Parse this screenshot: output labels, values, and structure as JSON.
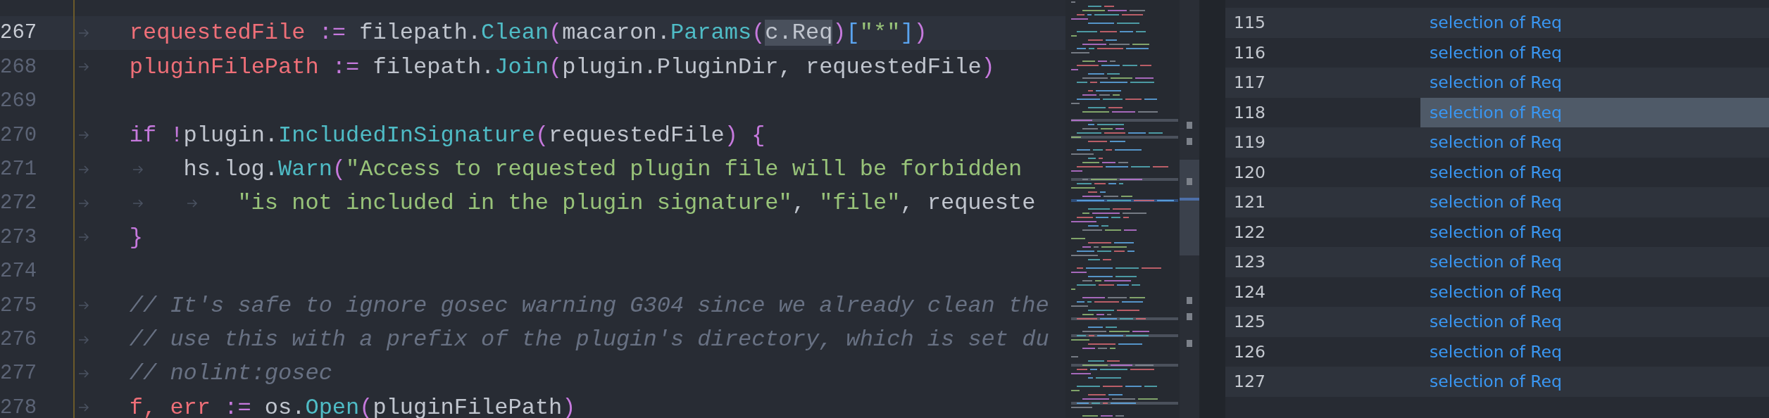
{
  "editor": {
    "lines": [
      {
        "number": "267",
        "current": true,
        "indent": [
          {
            "kind": "tab"
          }
        ],
        "tokens": [
          {
            "kind": "variable",
            "text": "requestedFile"
          },
          {
            "kind": "operator",
            "text": " := "
          },
          {
            "kind": "plain",
            "text": "filepath."
          },
          {
            "kind": "function",
            "text": "Clean"
          },
          {
            "kind": "paren",
            "text": "("
          },
          {
            "kind": "plain",
            "text": "macaron."
          },
          {
            "kind": "function",
            "text": "Params"
          },
          {
            "kind": "paren",
            "text": "("
          },
          {
            "kind": "match",
            "text": "c.Req"
          },
          {
            "kind": "paren",
            "text": ")"
          },
          {
            "kind": "bracket",
            "text": "["
          },
          {
            "kind": "string",
            "text": "\"*\""
          },
          {
            "kind": "bracket",
            "text": "]"
          },
          {
            "kind": "paren",
            "text": ")"
          }
        ]
      },
      {
        "number": "268",
        "current": false,
        "indent": [
          {
            "kind": "tab"
          }
        ],
        "tokens": [
          {
            "kind": "variable",
            "text": "pluginFilePath"
          },
          {
            "kind": "operator",
            "text": " := "
          },
          {
            "kind": "plain",
            "text": "filepath."
          },
          {
            "kind": "function",
            "text": "Join"
          },
          {
            "kind": "paren",
            "text": "("
          },
          {
            "kind": "plain",
            "text": "plugin.PluginDir, requestedFile"
          },
          {
            "kind": "paren",
            "text": ")"
          }
        ]
      },
      {
        "number": "269",
        "current": false
      },
      {
        "number": "270",
        "current": false,
        "indent": [
          {
            "kind": "tab"
          }
        ],
        "tokens": [
          {
            "kind": "keyword",
            "text": "if !"
          },
          {
            "kind": "plain",
            "text": "plugin."
          },
          {
            "kind": "function",
            "text": "IncludedInSignature"
          },
          {
            "kind": "paren",
            "text": "("
          },
          {
            "kind": "plain",
            "text": "requestedFile"
          },
          {
            "kind": "paren",
            "text": ") {"
          }
        ]
      },
      {
        "number": "271",
        "current": false,
        "indent": [
          {
            "kind": "tab"
          },
          {
            "kind": "tab"
          }
        ],
        "tokens": [
          {
            "kind": "plain",
            "text": "hs.log."
          },
          {
            "kind": "function",
            "text": "Warn"
          },
          {
            "kind": "paren",
            "text": "("
          },
          {
            "kind": "string",
            "text": "\"Access to requested plugin file will be forbidden"
          }
        ]
      },
      {
        "number": "272",
        "current": false,
        "indent": [
          {
            "kind": "tab"
          },
          {
            "kind": "tab"
          },
          {
            "kind": "tab"
          }
        ],
        "tokens": [
          {
            "kind": "string",
            "text": "\"is not included in the plugin signature\""
          },
          {
            "kind": "plain",
            "text": ", "
          },
          {
            "kind": "string",
            "text": "\"file\""
          },
          {
            "kind": "plain",
            "text": ", requeste"
          }
        ]
      },
      {
        "number": "273",
        "current": false,
        "indent": [
          {
            "kind": "tab"
          }
        ],
        "tokens": [
          {
            "kind": "paren",
            "text": "}"
          }
        ]
      },
      {
        "number": "274",
        "current": false
      },
      {
        "number": "275",
        "current": false,
        "indent": [
          {
            "kind": "tab"
          }
        ],
        "tokens": [
          {
            "kind": "comment",
            "text": "// It's safe to ignore gosec warning G304 since we already clean the"
          }
        ]
      },
      {
        "number": "276",
        "current": false,
        "indent": [
          {
            "kind": "tab"
          }
        ],
        "tokens": [
          {
            "kind": "comment",
            "text": "// use this with a prefix of the plugin's directory, which is set du"
          }
        ]
      },
      {
        "number": "277",
        "current": false,
        "indent": [
          {
            "kind": "tab"
          }
        ],
        "tokens": [
          {
            "kind": "comment",
            "text": "// nolint:gosec"
          }
        ]
      },
      {
        "number": "278",
        "current": false,
        "indent": [
          {
            "kind": "tab"
          }
        ],
        "tokens": [
          {
            "kind": "variable",
            "text": "f, err"
          },
          {
            "kind": "operator",
            "text": " := "
          },
          {
            "kind": "plain",
            "text": "os."
          },
          {
            "kind": "function",
            "text": "Open"
          },
          {
            "kind": "paren",
            "text": "("
          },
          {
            "kind": "plain",
            "text": "pluginFilePath"
          },
          {
            "kind": "paren",
            "text": ")"
          }
        ]
      }
    ]
  },
  "results": {
    "rows": [
      {
        "line": "115",
        "text": "selection of Req",
        "selected": false
      },
      {
        "line": "116",
        "text": "selection of Req",
        "selected": false
      },
      {
        "line": "117",
        "text": "selection of Req",
        "selected": false
      },
      {
        "line": "118",
        "text": "selection of Req",
        "selected": true
      },
      {
        "line": "119",
        "text": "selection of Req",
        "selected": false
      },
      {
        "line": "120",
        "text": "selection of Req",
        "selected": false
      },
      {
        "line": "121",
        "text": "selection of Req",
        "selected": false
      },
      {
        "line": "122",
        "text": "selection of Req",
        "selected": false
      },
      {
        "line": "123",
        "text": "selection of Req",
        "selected": false
      },
      {
        "line": "124",
        "text": "selection of Req",
        "selected": false
      },
      {
        "line": "125",
        "text": "selection of Req",
        "selected": false
      },
      {
        "line": "126",
        "text": "selection of Req",
        "selected": false
      },
      {
        "line": "127",
        "text": "selection of Req",
        "selected": false
      }
    ]
  }
}
